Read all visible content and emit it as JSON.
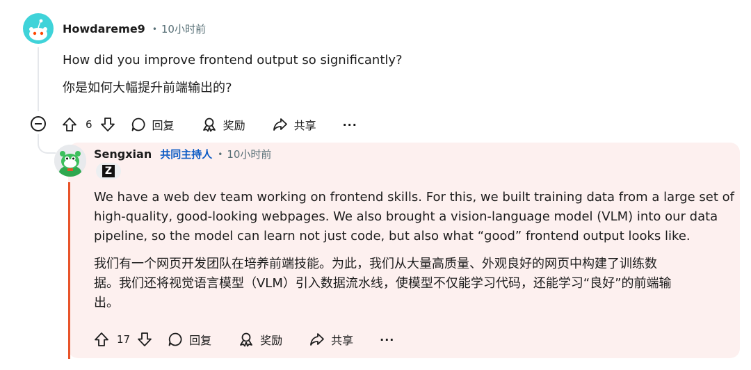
{
  "comment": {
    "username": "Howdareme9",
    "dot": "•",
    "time": "10小时前",
    "lines": [
      "How did you improve frontend output so significantly?",
      "你是如何大幅提升前端输出的?"
    ],
    "actions": {
      "vote_count": "6",
      "reply_label": "回复",
      "award_label": "奖励",
      "share_label": "共享",
      "more_label": "···"
    },
    "avatar_color": "#3fd3d9"
  },
  "reply": {
    "username": "Sengxian",
    "role": "共同主持人",
    "dot": "•",
    "time": "10小时前",
    "flair": "Z",
    "lines": [
      "We have a web dev team working on frontend skills. For this, we built training data from a large set of",
      "high-quality, good-looking webpages. We also brought a vision-language model (VLM) into our data",
      "pipeline, so the model can learn not just code, but also what “good” frontend output looks like.",
      "我们有一个网页开发团队在培养前端技能。为此，我们从大量高质量、外观良好的网页中构建了训练数",
      "据。我们还将视觉语言模型（VLM）引入数据流水线，使模型不仅能学习代码，还能学习“良好”的前端输",
      "出。"
    ],
    "actions": {
      "vote_count": "17",
      "reply_label": "回复",
      "award_label": "奖励",
      "share_label": "共享",
      "more_label": "···"
    },
    "role_color": "#0a59c4",
    "accent_line_color": "#e8542a",
    "background": "#fdf0ef"
  }
}
